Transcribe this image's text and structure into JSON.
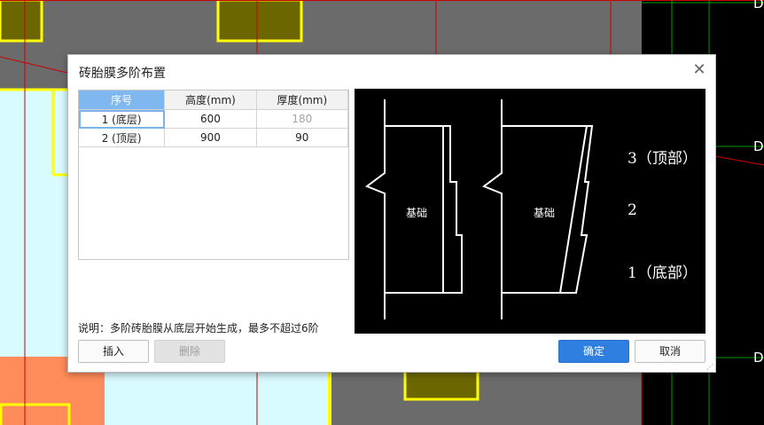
{
  "dialog": {
    "title": "砖胎膜多阶布置",
    "close_glyph": "✕"
  },
  "table": {
    "headers": [
      "序号",
      "高度(mm)",
      "厚度(mm)"
    ],
    "rows": [
      {
        "index": "1 (底层)",
        "height": "600",
        "thickness": "180"
      },
      {
        "index": "2 (顶层)",
        "height": "900",
        "thickness": "90"
      }
    ]
  },
  "note": "说明：多阶砖胎膜从底层开始生成，最多不超过6阶",
  "buttons": {
    "insert": "插入",
    "delete": "删除",
    "ok": "确定",
    "cancel": "取消"
  },
  "preview": {
    "foundation_label_left": "基础",
    "foundation_label_right": "基础",
    "level_3": "3（顶部）",
    "level_2": "2",
    "level_1": "1（底部）"
  },
  "background": {
    "side_labels": [
      "D",
      "D",
      "D"
    ]
  },
  "colors": {
    "cad_gray": "#6b6b6b",
    "cad_cyan": "#d8fbff",
    "cad_yellow": "#ffff00",
    "cad_olive": "#6b6600",
    "cad_orange": "#ff8c5a",
    "cad_red": "#cc0000",
    "cad_green": "#00a000",
    "accent_blue": "#2f7fe0",
    "header_selected": "#7fb8f1"
  }
}
